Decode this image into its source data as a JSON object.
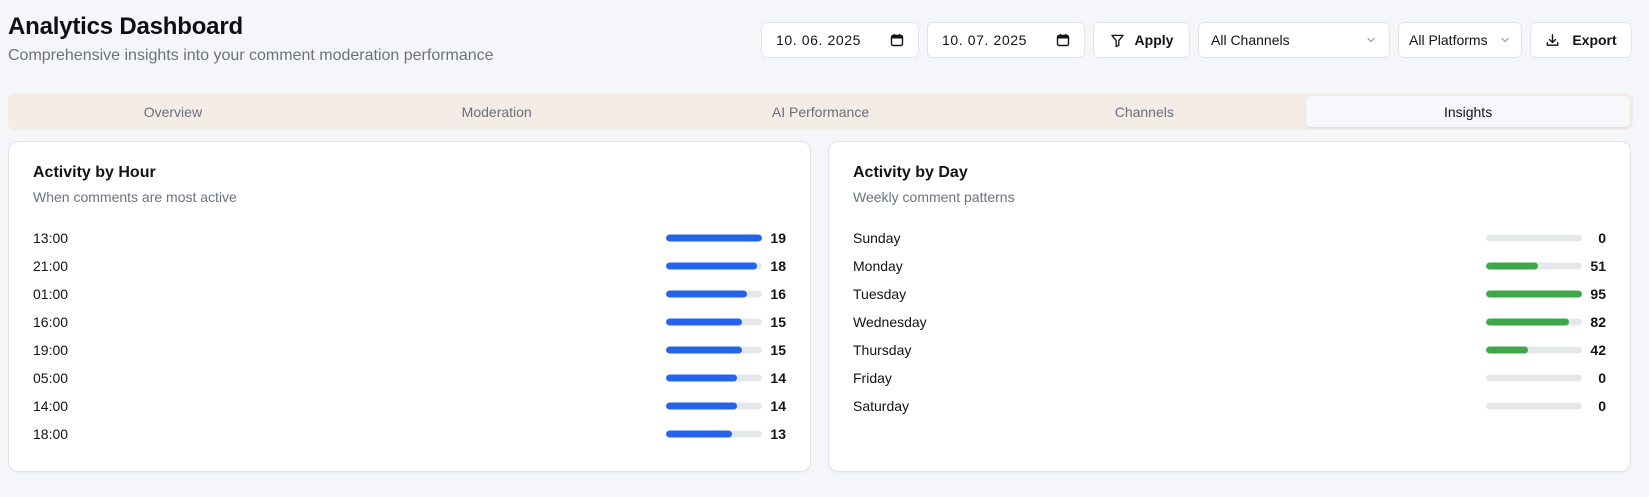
{
  "header": {
    "title": "Analytics Dashboard",
    "subtitle": "Comprehensive insights into your comment moderation performance"
  },
  "controls": {
    "date_from": "10. 06. 2025",
    "date_to": "10. 07. 2025",
    "apply_label": "Apply",
    "channels_selected": "All Channels",
    "platforms_selected": "All Platforms",
    "export_label": "Export"
  },
  "tabs": [
    {
      "label": "Overview",
      "active": false
    },
    {
      "label": "Moderation",
      "active": false
    },
    {
      "label": "AI Performance",
      "active": false
    },
    {
      "label": "Channels",
      "active": false
    },
    {
      "label": "Insights",
      "active": true
    }
  ],
  "colors": {
    "hour_bar": "#2563eb",
    "day_bar": "#3fa748",
    "track": "#e6e7ea"
  },
  "hour_card": {
    "title": "Activity by Hour",
    "description": "When comments are most active",
    "max": 19,
    "rows": [
      {
        "label": "13:00",
        "value": 19
      },
      {
        "label": "21:00",
        "value": 18
      },
      {
        "label": "01:00",
        "value": 16
      },
      {
        "label": "16:00",
        "value": 15
      },
      {
        "label": "19:00",
        "value": 15
      },
      {
        "label": "05:00",
        "value": 14
      },
      {
        "label": "14:00",
        "value": 14
      },
      {
        "label": "18:00",
        "value": 13
      }
    ]
  },
  "day_card": {
    "title": "Activity by Day",
    "description": "Weekly comment patterns",
    "max": 95,
    "rows": [
      {
        "label": "Sunday",
        "value": 0
      },
      {
        "label": "Monday",
        "value": 51
      },
      {
        "label": "Tuesday",
        "value": 95
      },
      {
        "label": "Wednesday",
        "value": 82
      },
      {
        "label": "Thursday",
        "value": 42
      },
      {
        "label": "Friday",
        "value": 0
      },
      {
        "label": "Saturday",
        "value": 0
      }
    ]
  }
}
